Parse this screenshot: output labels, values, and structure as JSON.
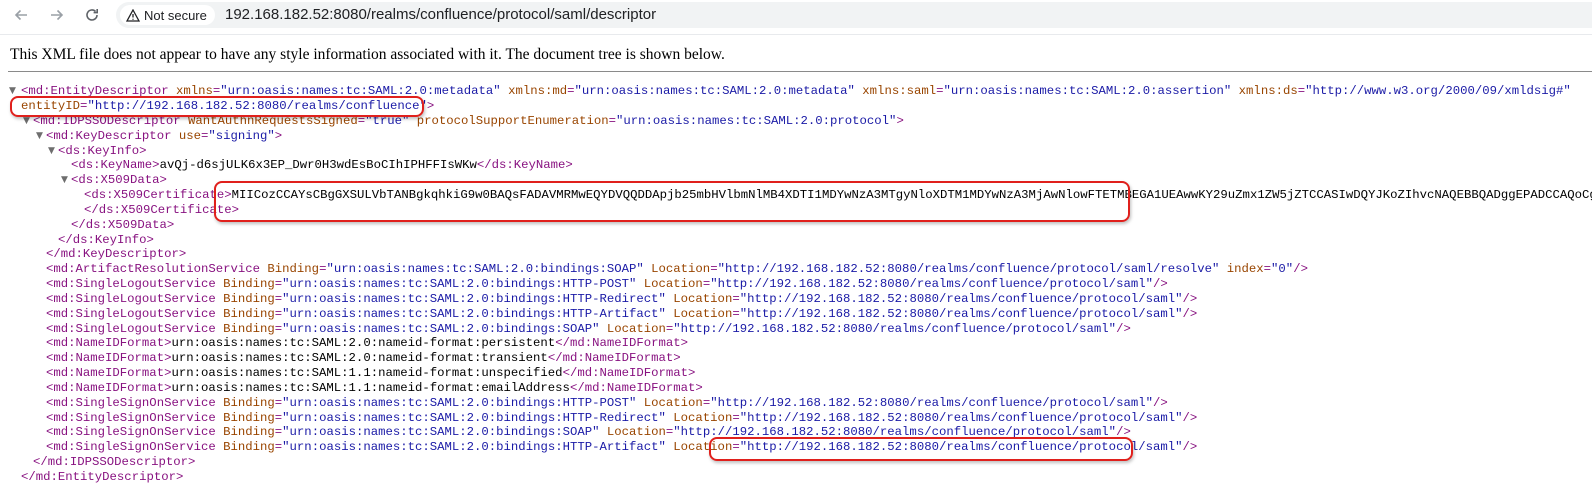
{
  "browser": {
    "back_icon": "arrow-left-icon",
    "forward_icon": "arrow-right-icon",
    "reload_icon": "reload-icon",
    "security_icon": "warning-triangle-icon",
    "security_label": "Not secure",
    "url": "192.168.182.52:8080/realms/confluence/protocol/saml/descriptor"
  },
  "page": {
    "info_text": "This XML file does not appear to have any style information associated with it. The document tree is shown below."
  },
  "xml": {
    "entity_descriptor": {
      "open": "<md:EntityDescriptor",
      "attrs": [
        {
          "name": " xmlns",
          "value": "\"urn:oasis:names:tc:SAML:2.0:metadata\""
        },
        {
          "name": " xmlns:md",
          "value": "\"urn:oasis:names:tc:SAML:2.0:metadata\""
        },
        {
          "name": " xmlns:saml",
          "value": "\"urn:oasis:names:tc:SAML:2.0:assertion\""
        },
        {
          "name": " xmlns:ds",
          "value": "\"http://www.w3.org/2000/09/xmldsig#\""
        }
      ],
      "entity_id_name": "entityID",
      "entity_id_value": "\"http://192.168.182.52:8080/realms/confluence\"",
      "close_bracket": ">",
      "close": "</md:EntityDescriptor>"
    },
    "idpsso": {
      "open": "<md:IDPSSODescriptor",
      "a1_name": " WantAuthnRequestsSigned",
      "a1_value": "\"true\"",
      "a2_name": " protocolSupportEnumeration",
      "a2_value": "\"urn:oasis:names:tc:SAML:2.0:protocol\"",
      "gt": ">",
      "close": "</md:IDPSSODescriptor>"
    },
    "key_descriptor": {
      "open": "<md:KeyDescriptor",
      "a_name": " use",
      "a_value": "\"signing\"",
      "gt": ">",
      "close": "</md:KeyDescriptor>"
    },
    "key_info": {
      "open": "<ds:KeyInfo>",
      "close": "</ds:KeyInfo>"
    },
    "key_name": {
      "open": "<ds:KeyName>",
      "text": "avQj-d6sjULK6x3EP_Dwr0H3wdEsBoCIhIPHFFIsWKw",
      "close": "</ds:KeyName>"
    },
    "x509_data": {
      "open": "<ds:X509Data>",
      "close": "</ds:X509Data>"
    },
    "x509_cert": {
      "open": "<ds:X509Certificate>",
      "text": "MIICozCCAYsCBgGXSULVbTANBgkqhkiG9w0BAQsFADAVMRMwEQYDVQQDDApjb25mbHVlbmNlMB4XDTI1MDYwNzA3MTgyNloXDTM1MDYwNzA3MjAwNlowFTETMBEGA1UEAwwKY29uZmx1ZW5jZTCCASIwDQYJKoZIhvcNAQEBBQADggEPADCCAQoCggEBALA",
      "close": "</ds:X509Certificate>"
    },
    "artifact_resolution": {
      "open": "<md:ArtifactResolutionService",
      "b_name": " Binding",
      "b_value": "\"urn:oasis:names:tc:SAML:2.0:bindings:SOAP\"",
      "l_name": " Location",
      "l_value": "\"http://192.168.182.52:8080/realms/confluence/protocol/saml/resolve\"",
      "i_name": " index",
      "i_value": "\"0\"",
      "end": "/>"
    },
    "single_logout": [
      {
        "open": "<md:SingleLogoutService",
        "b_name": " Binding",
        "b_value": "\"urn:oasis:names:tc:SAML:2.0:bindings:HTTP-POST\"",
        "l_name": " Location",
        "l_value": "\"http://192.168.182.52:8080/realms/confluence/protocol/saml\"",
        "end": "/>"
      },
      {
        "open": "<md:SingleLogoutService",
        "b_name": " Binding",
        "b_value": "\"urn:oasis:names:tc:SAML:2.0:bindings:HTTP-Redirect\"",
        "l_name": " Location",
        "l_value": "\"http://192.168.182.52:8080/realms/confluence/protocol/saml\"",
        "end": "/>"
      },
      {
        "open": "<md:SingleLogoutService",
        "b_name": " Binding",
        "b_value": "\"urn:oasis:names:tc:SAML:2.0:bindings:HTTP-Artifact\"",
        "l_name": " Location",
        "l_value": "\"http://192.168.182.52:8080/realms/confluence/protocol/saml\"",
        "end": "/>"
      },
      {
        "open": "<md:SingleLogoutService",
        "b_name": " Binding",
        "b_value": "\"urn:oasis:names:tc:SAML:2.0:bindings:SOAP\"",
        "l_name": " Location",
        "l_value": "\"http://192.168.182.52:8080/realms/confluence/protocol/saml\"",
        "end": "/>"
      }
    ],
    "name_id_formats": [
      {
        "open": "<md:NameIDFormat>",
        "text": "urn:oasis:names:tc:SAML:2.0:nameid-format:persistent",
        "close": "</md:NameIDFormat>"
      },
      {
        "open": "<md:NameIDFormat>",
        "text": "urn:oasis:names:tc:SAML:2.0:nameid-format:transient",
        "close": "</md:NameIDFormat>"
      },
      {
        "open": "<md:NameIDFormat>",
        "text": "urn:oasis:names:tc:SAML:1.1:nameid-format:unspecified",
        "close": "</md:NameIDFormat>"
      },
      {
        "open": "<md:NameIDFormat>",
        "text": "urn:oasis:names:tc:SAML:1.1:nameid-format:emailAddress",
        "close": "</md:NameIDFormat>"
      }
    ],
    "single_sign_on": [
      {
        "open": "<md:SingleSignOnService",
        "b_name": " Binding",
        "b_value": "\"urn:oasis:names:tc:SAML:2.0:bindings:HTTP-POST\"",
        "l_name": " Location",
        "l_value": "\"http://192.168.182.52:8080/realms/confluence/protocol/saml\"",
        "end": "/>"
      },
      {
        "open": "<md:SingleSignOnService",
        "b_name": " Binding",
        "b_value": "\"urn:oasis:names:tc:SAML:2.0:bindings:HTTP-Redirect\"",
        "l_name": " Location",
        "l_value": "\"http://192.168.182.52:8080/realms/confluence/protocol/saml\"",
        "end": "/>"
      },
      {
        "open": "<md:SingleSignOnService",
        "b_name": " Binding",
        "b_value": "\"urn:oasis:names:tc:SAML:2.0:bindings:SOAP\"",
        "l_name": " Location",
        "l_value": "\"http://192.168.182.52:8080/realms/confluence/protocol/saml\"",
        "end": "/>"
      },
      {
        "open": "<md:SingleSignOnService",
        "b_name": " Binding",
        "b_value": "\"urn:oasis:names:tc:SAML:2.0:bindings:HTTP-Artifact\"",
        "l_name": " Location",
        "l_value": "\"http://192.168.182.52:8080/realms/confluence/protocol/saml\"",
        "end": "/>"
      }
    ]
  },
  "annotations": {
    "color": "#e0201c",
    "highlighted": [
      "entity-id",
      "x509-certificate",
      "sso-artifact-location"
    ]
  }
}
